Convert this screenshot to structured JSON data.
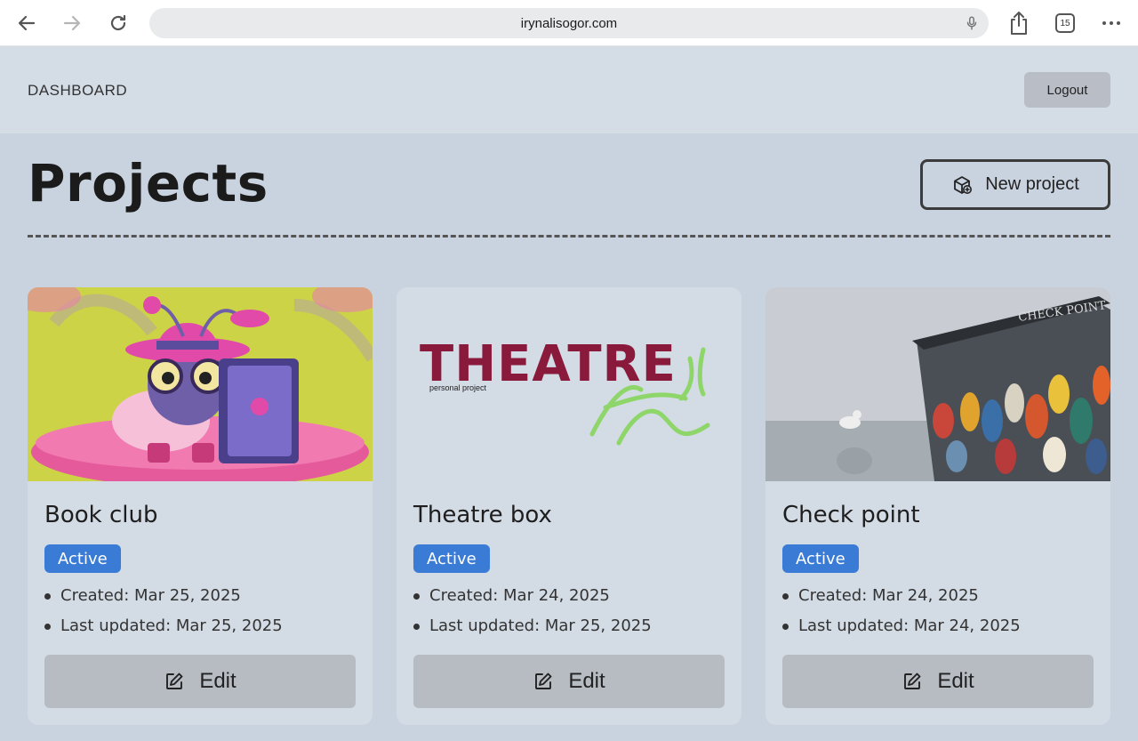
{
  "browser": {
    "url": "irynalisogor.com",
    "tab_count": "15"
  },
  "header": {
    "brand": "DASHBOARD",
    "logout_label": "Logout"
  },
  "page": {
    "title": "Projects",
    "new_project_label": "New project"
  },
  "theme": {
    "accent": "#3a7bd5",
    "button_gray": "#b7bcc3",
    "background": "#c9d3e0"
  },
  "projects": [
    {
      "title": "Book club",
      "status": "Active",
      "created": "Created: Mar 25, 2025",
      "updated": "Last updated: Mar 25, 2025",
      "edit_label": "Edit"
    },
    {
      "title": "Theatre box",
      "status": "Active",
      "created": "Created: Mar 24, 2025",
      "updated": "Last updated: Mar 25, 2025",
      "edit_label": "Edit",
      "image_text": "THEATRE",
      "image_subtext": "personal project"
    },
    {
      "title": "Check point",
      "status": "Active",
      "created": "Created: Mar 24, 2025",
      "updated": "Last updated: Mar 24, 2025",
      "edit_label": "Edit",
      "image_text": "CHECK POINT"
    }
  ]
}
